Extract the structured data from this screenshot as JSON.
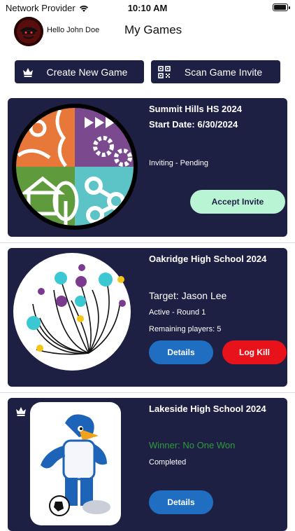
{
  "status_bar": {
    "carrier": "Network Provider",
    "time": "10:10 AM",
    "battery_level": 0.9
  },
  "header": {
    "greeting": "Hello John Doe",
    "title": "My Games"
  },
  "actions": {
    "create_label": "Create New Game",
    "scan_label": "Scan Game Invite"
  },
  "games": [
    {
      "name": "Summit Hills HS 2024",
      "start_date": "Start Date: 6/30/2024",
      "status": "Inviting - Pending",
      "accept_label": "Accept Invite"
    },
    {
      "name": "Oakridge High School 2024",
      "target": "Target: Jason Lee",
      "status": "Active - Round 1",
      "remaining": "Remaining players: 5",
      "details_label": "Details",
      "logkill_label": "Log Kill"
    },
    {
      "name": "Lakeside High School 2024",
      "winner": "Winner: No One Won",
      "status": "Completed",
      "details_label": "Details"
    }
  ],
  "colors": {
    "card_bg": "#1e2043",
    "accept_bg": "#b9f5d4",
    "details_bg": "#1f6ec2",
    "logkill_bg": "#e8121b",
    "winner_text": "#2e9b3c"
  }
}
